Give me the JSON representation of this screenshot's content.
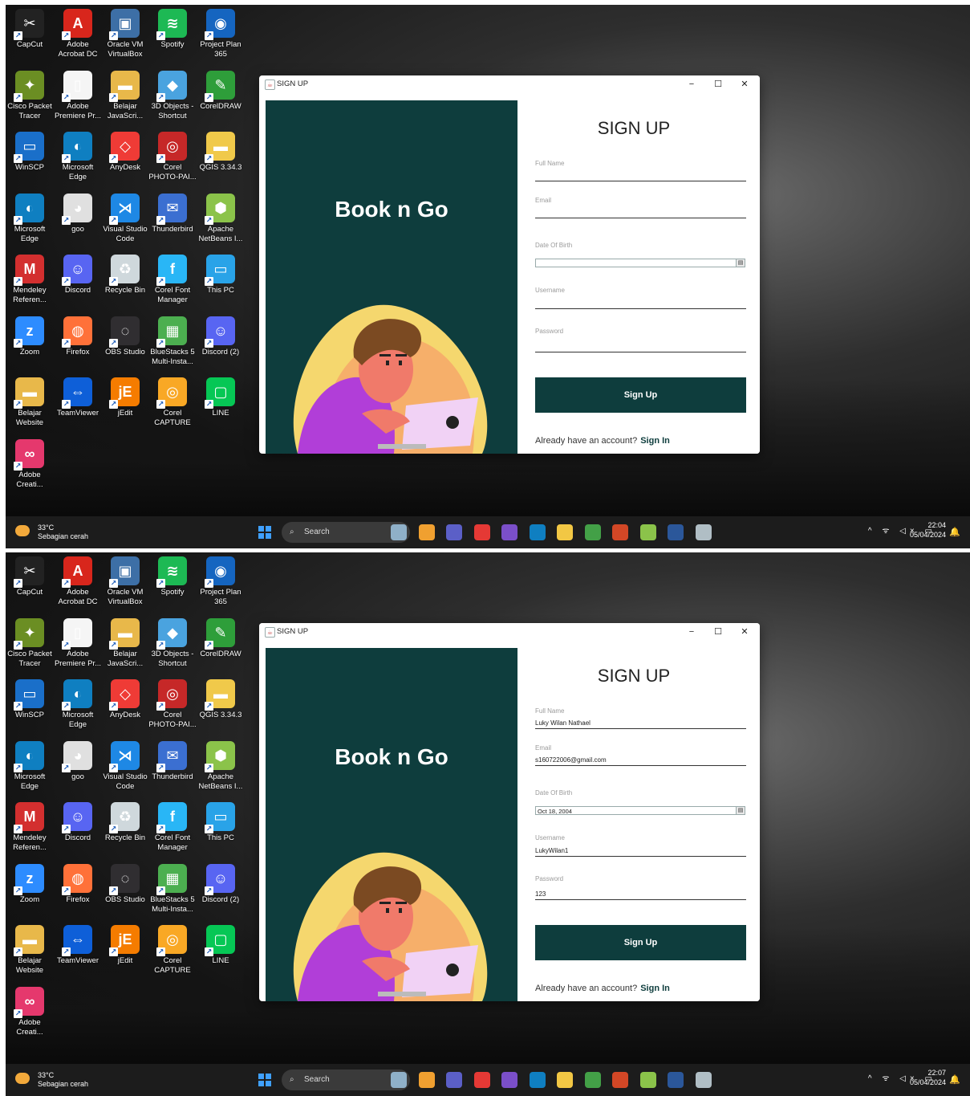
{
  "desktop_icons": [
    {
      "label": "CapCut",
      "color": "#222222",
      "glyph": "✂"
    },
    {
      "label": "Adobe Acrobat DC",
      "color": "#d8261c",
      "glyph": "A"
    },
    {
      "label": "Oracle VM VirtualBox",
      "color": "#3d6fa6",
      "glyph": "▣"
    },
    {
      "label": "Spotify",
      "color": "#1db954",
      "glyph": "≋"
    },
    {
      "label": "Project Plan 365",
      "color": "#1565c0",
      "glyph": "◉"
    },
    {
      "label": "Cisco Packet Tracer",
      "color": "#6b8e23",
      "glyph": "✦"
    },
    {
      "label": "Adobe Premiere Pr...",
      "color": "#f5f5f5",
      "glyph": "▯"
    },
    {
      "label": "Belajar JavaScri...",
      "color": "#e8b84a",
      "glyph": "▬"
    },
    {
      "label": "3D Objects - Shortcut",
      "color": "#4aa3df",
      "glyph": "◆"
    },
    {
      "label": "CorelDRAW",
      "color": "#2e9e3a",
      "glyph": "✎"
    },
    {
      "label": "WinSCP",
      "color": "#1a6fc9",
      "glyph": "▭"
    },
    {
      "label": "Microsoft Edge",
      "color": "#0f7fc1",
      "glyph": "◐"
    },
    {
      "label": "AnyDesk",
      "color": "#ef3b36",
      "glyph": "◇"
    },
    {
      "label": "Corel PHOTO-PAI...",
      "color": "#c62828",
      "glyph": "◎"
    },
    {
      "label": "QGIS 3.34.3",
      "color": "#f0c94a",
      "glyph": "▬"
    },
    {
      "label": "Microsoft Edge",
      "color": "#0f7fc1",
      "glyph": "◐"
    },
    {
      "label": "goo",
      "color": "#e0e0e0",
      "glyph": "◕"
    },
    {
      "label": "Visual Studio Code",
      "color": "#1e88e5",
      "glyph": "⋊"
    },
    {
      "label": "Thunderbird",
      "color": "#3b6fd1",
      "glyph": "✉"
    },
    {
      "label": "Apache NetBeans I...",
      "color": "#8bc34a",
      "glyph": "⬢"
    },
    {
      "label": "Mendeley Referen...",
      "color": "#d32f2f",
      "glyph": "M"
    },
    {
      "label": "Discord",
      "color": "#5865f2",
      "glyph": "☺"
    },
    {
      "label": "Recycle Bin",
      "color": "#cfd8dc",
      "glyph": "♻"
    },
    {
      "label": "Corel Font Manager",
      "color": "#29b6f6",
      "glyph": "f"
    },
    {
      "label": "This PC",
      "color": "#29a3e8",
      "glyph": "▭"
    },
    {
      "label": "Zoom",
      "color": "#2d8cff",
      "glyph": "z"
    },
    {
      "label": "Firefox",
      "color": "#ff7139",
      "glyph": "◍"
    },
    {
      "label": "OBS Studio",
      "color": "#302e31",
      "glyph": "◌"
    },
    {
      "label": "BlueStacks 5 Multi-Insta...",
      "color": "#4caf50",
      "glyph": "▦"
    },
    {
      "label": "Discord (2)",
      "color": "#5865f2",
      "glyph": "☺"
    },
    {
      "label": "Belajar Website",
      "color": "#e8b84a",
      "glyph": "▬"
    },
    {
      "label": "TeamViewer",
      "color": "#0e5fd8",
      "glyph": "⇔"
    },
    {
      "label": "jEdit",
      "color": "#f57c00",
      "glyph": "jE"
    },
    {
      "label": "Corel CAPTURE",
      "color": "#f9a825",
      "glyph": "◎"
    },
    {
      "label": "LINE",
      "color": "#06c755",
      "glyph": "▢"
    },
    {
      "label": "Adobe Creati...",
      "color": "#e5386d",
      "glyph": "∞"
    }
  ],
  "window": {
    "title": "SIGN UP",
    "min": "−",
    "max": "☐",
    "close": "✕",
    "brand": "Book n Go",
    "heading": "SIGN UP",
    "labels": {
      "full_name": "Full Name",
      "email": "Email",
      "dob": "Date Of Birth",
      "username": "Username",
      "password": "Password"
    },
    "sign_up_button": "Sign Up",
    "already": "Already have an account?",
    "sign_in": "Sign In",
    "date_icon": "▤"
  },
  "states": [
    {
      "full_name": "",
      "email": "",
      "dob": "",
      "username": "",
      "password": "",
      "time": "22:04",
      "date": "05/04/2024"
    },
    {
      "full_name": "Luky Wilan Nathael",
      "email": "s160722006@gmail.com",
      "dob": "Oct 18, 2004",
      "username": "LukyWilan1",
      "password": "123",
      "time": "22:07",
      "date": "05/04/2024"
    }
  ],
  "taskbar": {
    "weather_temp": "33°C",
    "weather_desc": "Sebagian cerah",
    "search_placeholder": "Search",
    "search_glyph": "⌕",
    "apps": [
      {
        "name": "taskbar-landscape-widget",
        "color": "#8fb0c8"
      },
      {
        "name": "taskbar-copilot",
        "color": "#f0a030"
      },
      {
        "name": "taskbar-teams",
        "color": "#5b5fc7"
      },
      {
        "name": "taskbar-chrome",
        "color": "#e53935"
      },
      {
        "name": "taskbar-vs",
        "color": "#7b4fc9"
      },
      {
        "name": "taskbar-edge",
        "color": "#0f7fc1"
      },
      {
        "name": "taskbar-file-explorer",
        "color": "#f2c744"
      },
      {
        "name": "taskbar-chrome-2",
        "color": "#43a047"
      },
      {
        "name": "taskbar-powerpoint",
        "color": "#d24726"
      },
      {
        "name": "taskbar-netbeans",
        "color": "#8bc34a"
      },
      {
        "name": "taskbar-word",
        "color": "#2b579a"
      },
      {
        "name": "taskbar-java-app",
        "color": "#b0bec5"
      }
    ],
    "tray": "^ ᯤ ◁× ▭",
    "bell": "🔔"
  }
}
